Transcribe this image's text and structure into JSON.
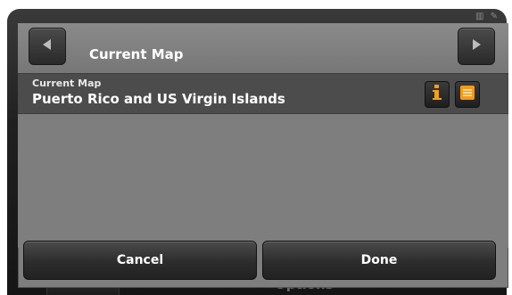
{
  "window": {
    "title": "Current Map",
    "accent": "#7e7e7e",
    "dark_bg": "#202020"
  },
  "background": {
    "status_icons": "▥ ✎",
    "under_text": "Options"
  },
  "nav": {
    "prev_icon": "triangle-left-icon",
    "next_icon": "triangle-right-icon"
  },
  "current_map": {
    "label": "Current Map",
    "value": "Puerto Rico and US Virgin Islands",
    "info_icon": "info-icon",
    "list_icon": "list-icon",
    "list_icon_color": "#f29a1a",
    "info_icon_color": "#f0a21c"
  },
  "buttons": {
    "cancel": "Cancel",
    "done": "Done"
  }
}
